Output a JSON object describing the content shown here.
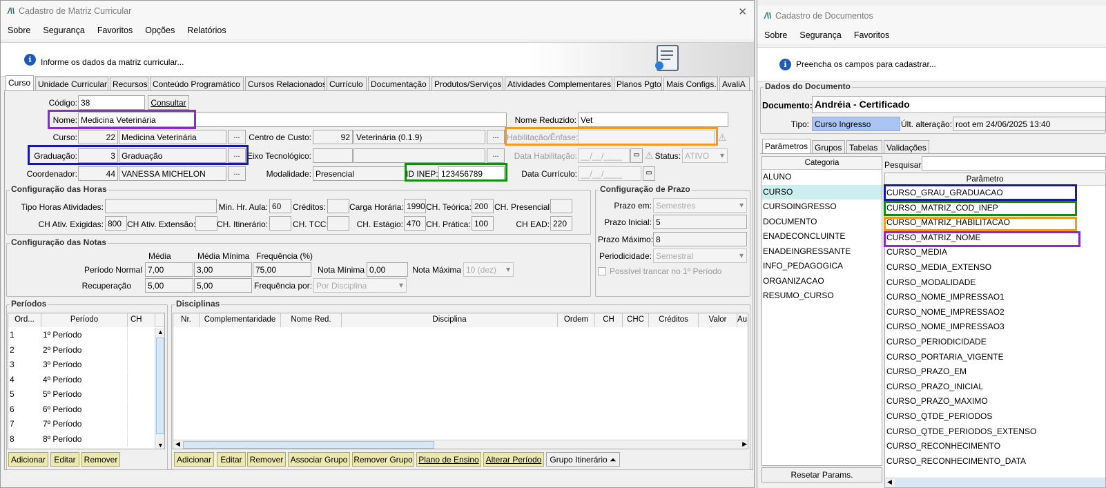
{
  "left": {
    "title": "Cadastro de Matriz Curricular",
    "close": "✕",
    "menu": [
      "Sobre",
      "Segurança",
      "Favoritos",
      "Opções",
      "Relatórios"
    ],
    "banner": "Informe os dados da matriz curricular...",
    "tabs": [
      "Curso",
      "Unidade Curricular",
      "Recursos",
      "Conteúdo Programático",
      "Cursos Relacionados",
      "Currículo",
      "Documentação",
      "Produtos/Serviços",
      "Atividades Complementares",
      "Planos Pgto",
      "Mais Configs.",
      "AvaliA"
    ],
    "form": {
      "codigo_label": "Código:",
      "codigo": "38",
      "consultar": "Consultar",
      "nome_label": "Nome:",
      "nome": "Medicina Veterinária",
      "nome_reduzido_label": "Nome Reduzido:",
      "nome_reduzido": "Vet",
      "curso_label": "Curso:",
      "curso_id": "22",
      "curso": "Medicina Veterinária",
      "centro_label": "Centro de Custo:",
      "centro_id": "92",
      "centro": "Veterinária (0.1.9)",
      "habilitacao_label": "Habilitação/Ênfase:",
      "graduacao_label": "Graduação:",
      "graduacao_id": "3",
      "graduacao": "Graduação",
      "eixo_label": "Eixo Tecnológico:",
      "data_hab_label": "Data Habilitação:",
      "data_hab": "__/__/____",
      "status_label": "Status:",
      "status": "ATIVO",
      "coord_label": "Coordenador:",
      "coord_id": "44",
      "coord": "VANESSA MICHELON",
      "modalidade_label": "Modalidade:",
      "modalidade": "Presencial",
      "inep_label": "ID INEP:",
      "inep": "123456789",
      "data_curr_label": "Data Currículo:",
      "data_curr": "__/__/____",
      "dots": "..."
    },
    "horas": {
      "title": "Configuração das Horas",
      "tipo_label": "Tipo Horas Atividades:",
      "min_label": "Min. Hr. Aula:",
      "min": "60",
      "creditos_label": "Créditos:",
      "ch_label": "Carga Horária:",
      "ch": "1990",
      "teorica_label": "CH. Teórica:",
      "teorica": "200",
      "presencial_label": "CH. Presencial:",
      "exigidas_label": "CH Ativ. Exigidas:",
      "exigidas": "800",
      "extensao_label": "CH Ativ. Extensão:",
      "itinerario_label": "CH. Itinerário:",
      "tcc_label": "CH. TCC:",
      "estagio_label": "CH. Estágio:",
      "estagio": "470",
      "pratica_label": "CH. Prática:",
      "pratica": "100",
      "ead_label": "CH EAD:",
      "ead": "220"
    },
    "prazo": {
      "title": "Configuração de Prazo",
      "em_label": "Prazo em:",
      "em": "Semestres",
      "inicial_label": "Prazo Inicial:",
      "inicial": "5",
      "maximo_label": "Prazo Máximo:",
      "maximo": "8",
      "period_label": "Periodicidade:",
      "period": "Semestral",
      "trancar": "Possível trancar no 1º Período"
    },
    "notas": {
      "title": "Configuração das Notas",
      "media_h": "Média",
      "media_min_h": "Média Mínima",
      "freq_h": "Frequência (%)",
      "normal_label": "Período Normal",
      "normal_media": "7,00",
      "normal_min": "3,00",
      "normal_freq": "75,00",
      "nota_min_label": "Nota Mínima",
      "nota_min": "0,00",
      "nota_max_label": "Nota Máxima",
      "nota_max": "10 (dez)",
      "rec_label": "Recuperação",
      "rec_media": "5,00",
      "rec_min": "5,00",
      "freq_por_label": "Frequência por:",
      "freq_por": "Por Disciplina"
    },
    "periodos": {
      "title": "Períodos",
      "headers": [
        "Ord...",
        "Período",
        "CH"
      ],
      "rows": [
        [
          "1",
          "1º Período"
        ],
        [
          "2",
          "2º Período"
        ],
        [
          "3",
          "3º Período"
        ],
        [
          "4",
          "4º Período"
        ],
        [
          "5",
          "5º Período"
        ],
        [
          "6",
          "6º Período"
        ],
        [
          "7",
          "7º Período"
        ],
        [
          "8",
          "8º Período"
        ]
      ],
      "buttons": [
        "Adicionar",
        "Editar",
        "Remover"
      ]
    },
    "disciplinas": {
      "title": "Disciplinas",
      "headers": [
        "Nr.",
        "Complementaridade",
        "Nome Red.",
        "Disciplina",
        "Ordem",
        "CH",
        "CHC",
        "Créditos",
        "Valor",
        "Au"
      ],
      "buttons": [
        "Adicionar",
        "Editar",
        "Remover",
        "Associar Grupo",
        "Remover Grupo",
        "Plano de Ensino",
        "Alterar Período"
      ],
      "grupo_itinerario": "Grupo Itinerário ⏶"
    }
  },
  "right": {
    "title": "Cadastro de Documentos",
    "menu": [
      "Sobre",
      "Segurança",
      "Favoritos"
    ],
    "banner": "Preencha os campos para cadastrar...",
    "dados_title": "Dados do Documento",
    "documento_label": "Documento:",
    "documento": "Andréia - Certificado",
    "tipo_label": "Tipo:",
    "tipo": "Curso Ingresso",
    "ult_label": "Últ. alteração:",
    "ult": "root em 24/06/2025 13:40",
    "tabs": [
      "Parâmetros",
      "Grupos",
      "Tabelas",
      "Validações"
    ],
    "categoria_h": "Categoria",
    "categorias": [
      "ALUNO",
      "CURSO",
      "CURSOINGRESSO",
      "DOCUMENTO",
      "ENADECONCLUINTE",
      "ENADEINGRESSANTE",
      "INFO_PEDAGOGICA",
      "ORGANIZACAO",
      "RESUMO_CURSO"
    ],
    "pesquisar_label": "Pesquisar:",
    "parametro_h": "Parâmetro",
    "parametros": [
      "CURSO_GRAU_GRADUACAO",
      "CURSO_MATRIZ_COD_INEP",
      "CURSO_MATRIZ_HABILITACAO",
      "CURSO_MATRIZ_NOME",
      "CURSO_MEDIA",
      "CURSO_MEDIA_EXTENSO",
      "CURSO_MODALIDADE",
      "CURSO_NOME_IMPRESSAO1",
      "CURSO_NOME_IMPRESSAO2",
      "CURSO_NOME_IMPRESSAO3",
      "CURSO_PERIODICIDADE",
      "CURSO_PORTARIA_VIGENTE",
      "CURSO_PRAZO_EM",
      "CURSO_PRAZO_INICIAL",
      "CURSO_PRAZO_MAXIMO",
      "CURSO_QTDE_PERIODOS",
      "CURSO_QTDE_PERIODOS_EXTENSO",
      "CURSO_RECONHECIMENTO",
      "CURSO_RECONHECIMENTO_DATA"
    ],
    "resetar": "Resetar Params."
  },
  "colors": {
    "purple": "#8a2ac8",
    "navy": "#1818a8",
    "green": "#148a14",
    "orange": "#f39a1c",
    "selected": "#cdeeee",
    "tipo_bg": "#a9c4f5"
  }
}
